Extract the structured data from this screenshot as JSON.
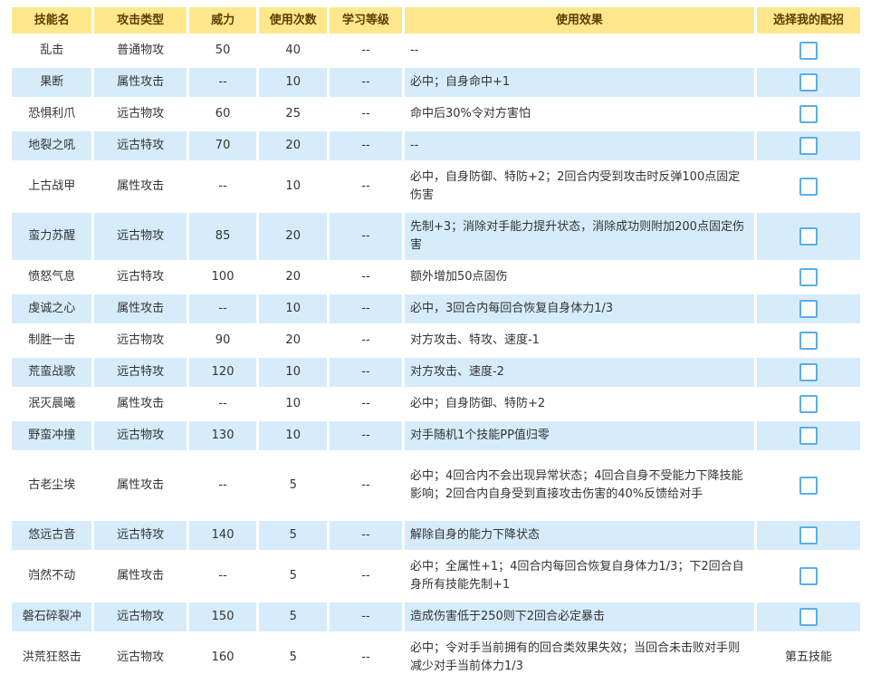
{
  "headers": [
    "技能名",
    "攻击类型",
    "威力",
    "使用次数",
    "学习等级",
    "使用效果",
    "选择我的配招"
  ],
  "rows": [
    {
      "name": "乱击",
      "type": "普通物攻",
      "power": "50",
      "pp": "40",
      "level": "--",
      "effect": "--",
      "select": "checkbox"
    },
    {
      "name": "果断",
      "type": "属性攻击",
      "power": "--",
      "pp": "10",
      "level": "--",
      "effect": "必中；自身命中+1",
      "select": "checkbox"
    },
    {
      "name": "恐惧利爪",
      "type": "远古物攻",
      "power": "60",
      "pp": "25",
      "level": "--",
      "effect": "命中后30%令对方害怕",
      "select": "checkbox"
    },
    {
      "name": "地裂之吼",
      "type": "远古特攻",
      "power": "70",
      "pp": "20",
      "level": "--",
      "effect": "--",
      "select": "checkbox"
    },
    {
      "name": "上古战甲",
      "type": "属性攻击",
      "power": "--",
      "pp": "10",
      "level": "--",
      "effect": "必中，自身防御、特防+2；2回合内受到攻击时反弹100点固定伤害",
      "select": "checkbox"
    },
    {
      "name": "蛮力苏醒",
      "type": "远古物攻",
      "power": "85",
      "pp": "20",
      "level": "--",
      "effect": "先制+3；消除对手能力提升状态，消除成功则附加200点固定伤害",
      "select": "checkbox"
    },
    {
      "name": "愤怒气息",
      "type": "远古特攻",
      "power": "100",
      "pp": "20",
      "level": "--",
      "effect": "额外增加50点固伤",
      "select": "checkbox"
    },
    {
      "name": "虔诚之心",
      "type": "属性攻击",
      "power": "--",
      "pp": "10",
      "level": "--",
      "effect": "必中，3回合内每回合恢复自身体力1/3",
      "select": "checkbox"
    },
    {
      "name": "制胜一击",
      "type": "远古物攻",
      "power": "90",
      "pp": "20",
      "level": "--",
      "effect": "对方攻击、特攻、速度-1",
      "select": "checkbox"
    },
    {
      "name": "荒蛮战歌",
      "type": "远古特攻",
      "power": "120",
      "pp": "10",
      "level": "--",
      "effect": "对方攻击、速度-2",
      "select": "checkbox"
    },
    {
      "name": "泯灭晨曦",
      "type": "属性攻击",
      "power": "--",
      "pp": "10",
      "level": "--",
      "effect": "必中；自身防御、特防+2",
      "select": "checkbox"
    },
    {
      "name": "野蛮冲撞",
      "type": "远古物攻",
      "power": "130",
      "pp": "10",
      "level": "--",
      "effect": "对手随机1个技能PP值归零",
      "select": "checkbox"
    },
    {
      "name": "古老尘埃",
      "type": "属性攻击",
      "power": "--",
      "pp": "5",
      "level": "--",
      "effect": "必中；4回合内不会出现异常状态；4回合自身不受能力下降技能影响；2回合内自身受到直接攻击伤害的40%反馈给对手",
      "select": "checkbox"
    },
    {
      "name": "悠远古音",
      "type": "远古特攻",
      "power": "140",
      "pp": "5",
      "level": "--",
      "effect": "解除自身的能力下降状态",
      "select": "checkbox"
    },
    {
      "name": "岿然不动",
      "type": "属性攻击",
      "power": "--",
      "pp": "5",
      "level": "--",
      "effect": "必中；全属性+1；4回合内每回合恢复自身体力1/3；下2回合自身所有技能先制+1",
      "select": "checkbox"
    },
    {
      "name": "磐石碎裂冲",
      "type": "远古物攻",
      "power": "150",
      "pp": "5",
      "level": "--",
      "effect": "造成伤害低于250则下2回合必定暴击",
      "select": "checkbox"
    },
    {
      "name": "洪荒狂怒击",
      "type": "远古物攻",
      "power": "160",
      "pp": "5",
      "level": "--",
      "effect": "必中；令对手当前拥有的回合类效果失效；当回合未击败对手则减少对手当前体力1/3",
      "select": "第五技能"
    }
  ],
  "colors": {
    "header_bg": "#ffe88b",
    "alt_row_bg": "#d6ecfb",
    "checkbox_border": "#5aaee8"
  }
}
